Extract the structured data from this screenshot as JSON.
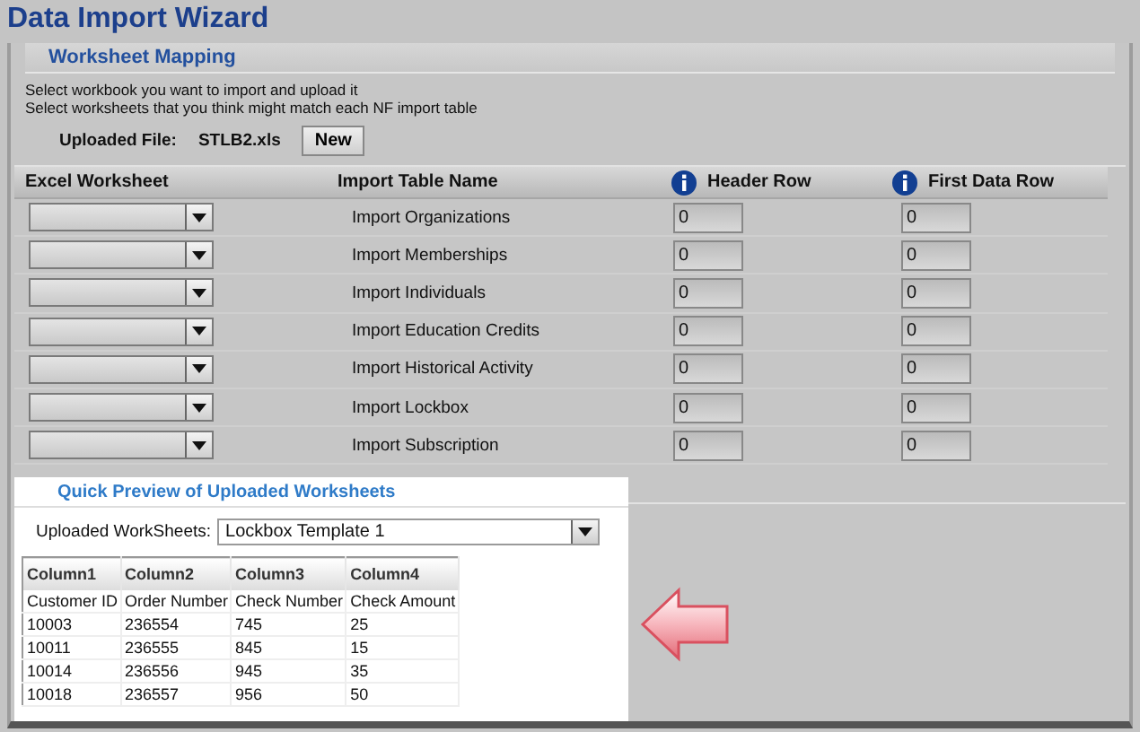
{
  "window": {
    "title": "Data Import Wizard"
  },
  "mapping": {
    "heading": "Worksheet Mapping",
    "instructions": [
      "Select workbook you want to import and upload it",
      "Select worksheets that you think might match each NF import table"
    ],
    "uploaded_file_label": "Uploaded File:",
    "uploaded_file": "STLB2.xls",
    "new_button": "New",
    "columns": [
      {
        "label": "Excel Worksheet",
        "info": false
      },
      {
        "label": "Import Table Name",
        "info": false
      },
      {
        "label": "Header Row",
        "info": true
      },
      {
        "label": "First Data Row",
        "info": true
      }
    ],
    "rows": [
      {
        "table_name": "Import Organizations",
        "header_row": "0",
        "first_data_row": "0"
      },
      {
        "table_name": "Import Memberships",
        "header_row": "0",
        "first_data_row": "0"
      },
      {
        "table_name": "Import Individuals",
        "header_row": "0",
        "first_data_row": "0"
      },
      {
        "table_name": "Import Education Credits",
        "header_row": "0",
        "first_data_row": "0"
      },
      {
        "table_name": "Import Historical Activity",
        "header_row": "0",
        "first_data_row": "0"
      },
      {
        "table_name": "Import Lockbox",
        "header_row": "0",
        "first_data_row": "0"
      },
      {
        "table_name": "Import Subscription",
        "header_row": "0",
        "first_data_row": "0"
      }
    ]
  },
  "preview": {
    "heading": "Quick Preview of Uploaded Worksheets",
    "worksheet_label": "Uploaded WorkSheets:",
    "worksheet": "Lockbox Template 1",
    "table": {
      "columns": [
        "Column1",
        "Column2",
        "Column3",
        "Column4"
      ],
      "rows": [
        [
          "Customer ID",
          "Order Number",
          "Check Number",
          "Check Amount"
        ],
        [
          "10003",
          "236554",
          "745",
          "25"
        ],
        [
          "10011",
          "236555",
          "845",
          "15"
        ],
        [
          "10014",
          "236556",
          "945",
          "35"
        ],
        [
          "10018",
          "236557",
          "956",
          "50"
        ]
      ]
    }
  }
}
